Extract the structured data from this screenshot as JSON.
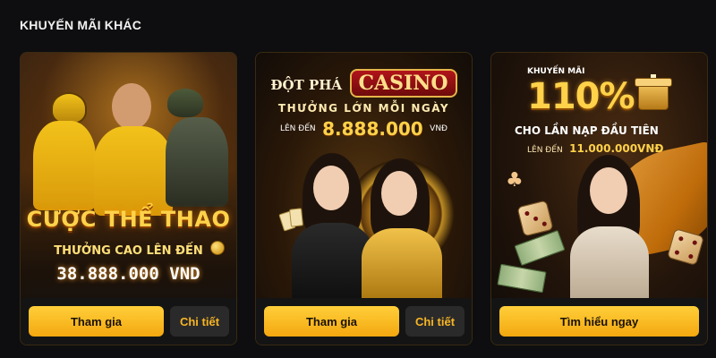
{
  "section": {
    "title": "KHUYẾN MÃI KHÁC"
  },
  "cards": [
    {
      "headline": "CƯỢC THỂ THAO",
      "subline": "THƯỞNG CAO LÊN ĐẾN",
      "amount": "38.888.000 VND",
      "primary_button": "Tham gia",
      "secondary_button": "Chi tiết"
    },
    {
      "headline_prefix": "ĐỘT PHÁ",
      "headline_badge": "CASINO",
      "subline": "THƯỞNG LỚN MỖI NGÀY",
      "amount_prefix": "LÊN ĐẾN",
      "amount": "8.888.000",
      "amount_suffix": "VNĐ",
      "primary_button": "Tham gia",
      "secondary_button": "Chi tiết"
    },
    {
      "kicker": "KHUYẾN MÃI",
      "percent": "110%",
      "subline": "CHO LẦN NẠP ĐẦU TIÊN",
      "amount_prefix": "LÊN ĐẾN",
      "amount": "11.000.000VNĐ",
      "primary_button": "Tìm hiểu ngay"
    }
  ],
  "colors": {
    "accent": "#f7b524",
    "button_gradient_top": "#ffcf3a",
    "button_gradient_bottom": "#f4a70f",
    "background": "#0e0e10"
  }
}
